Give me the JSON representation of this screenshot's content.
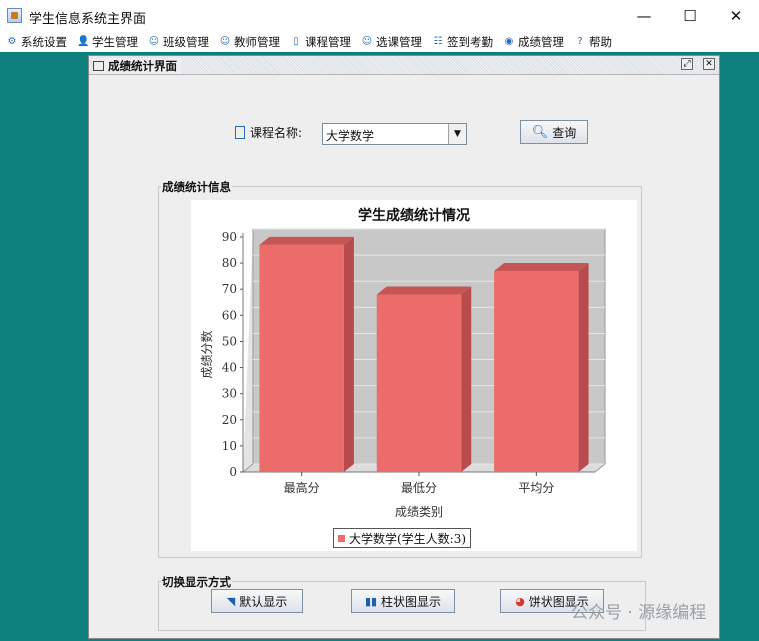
{
  "window": {
    "title": "学生信息系统主界面",
    "minimize_glyph": "—",
    "maximize_glyph": "☐",
    "close_glyph": "✕"
  },
  "menu": [
    {
      "label": "系统设置",
      "icon": "gear-icon"
    },
    {
      "label": "学生管理",
      "icon": "student-icon"
    },
    {
      "label": "班级管理",
      "icon": "class-icon"
    },
    {
      "label": "教师管理",
      "icon": "teacher-icon"
    },
    {
      "label": "课程管理",
      "icon": "course-icon"
    },
    {
      "label": "选课管理",
      "icon": "select-course-icon"
    },
    {
      "label": "签到考勤",
      "icon": "attendance-icon"
    },
    {
      "label": "成绩管理",
      "icon": "grade-icon"
    },
    {
      "label": "帮助",
      "icon": "help-icon"
    }
  ],
  "internal_frame": {
    "title": "成绩统计界面"
  },
  "query": {
    "course_label": "课程名称:",
    "course_value": "大学数学",
    "button_label": "查询"
  },
  "stats_group": {
    "title": "成绩统计信息"
  },
  "switch_group": {
    "title": "切换显示方式",
    "buttons": [
      {
        "label": "默认显示",
        "icon": "default-display-icon"
      },
      {
        "label": "柱状图显示",
        "icon": "bar-chart-icon"
      },
      {
        "label": "饼状图显示",
        "icon": "pie-chart-icon"
      }
    ]
  },
  "chart_data": {
    "type": "bar",
    "title": "学生成绩统计情况",
    "xlabel": "成绩类别",
    "ylabel": "成绩分数",
    "categories": [
      "最高分",
      "最低分",
      "平均分"
    ],
    "series": [
      {
        "name": "大学数学(学生人数:3)",
        "values": [
          87,
          68,
          77
        ],
        "color": "#ec6b6b"
      }
    ],
    "ylim": [
      0,
      90
    ],
    "yticks": [
      0,
      10,
      20,
      30,
      40,
      50,
      60,
      70,
      80,
      90
    ],
    "grid": true,
    "legend_position": "bottom",
    "background": "#c8c8c8"
  },
  "watermark": "公众号 · 源缘编程"
}
